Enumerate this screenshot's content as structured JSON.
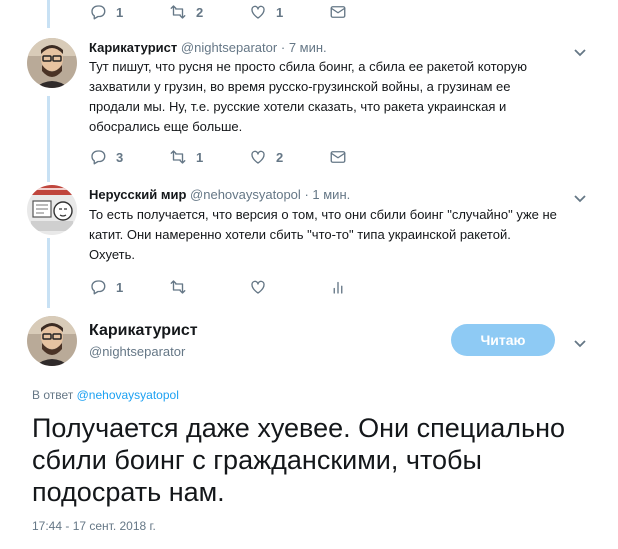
{
  "top_actions": {
    "reply_count": "1",
    "retweet_count": "2",
    "like_count": "1"
  },
  "tweets": [
    {
      "name": "Карикатурист",
      "handle": "@nightseparator",
      "sep": "·",
      "time": "7 мин.",
      "lines": [
        "Тут пишут, что русня не просто сбила боинг, а сбила ее ракетой которую",
        "захватили у грузин, во время русско-грузинской войны, а грузинам ее",
        "продали мы. Ну, т.е. русские хотели сказать, что ракета украинская и",
        "обосрались еще больше."
      ],
      "reply_count": "3",
      "retweet_count": "1",
      "like_count": "2"
    },
    {
      "name": "Нерусский мир",
      "handle": "@nehovaysyatopol",
      "sep": "·",
      "time": "1 мин.",
      "lines": [
        "То есть получается, что версия о том, что они сбили боинг \"случайно\" уже не",
        "катит. Они намеренно хотели сбить \"что-то\" типа украинской ракетой.",
        "Охуеть."
      ],
      "reply_count": "1"
    }
  ],
  "main_tweet": {
    "name": "Карикатурист",
    "handle": "@nightseparator",
    "follow_label": "Читаю",
    "reply_prefix": "В ответ",
    "reply_to": "@nehovaysyatopol",
    "lines": [
      "Получается даже хуевее. Они специально",
      "сбили боинг с гражданскими, чтобы",
      "подосрать нам."
    ],
    "timestamp": "17:44 - 17 сент. 2018 г."
  },
  "colors": {
    "accent": "#1da1f2",
    "follow_button": "#8ecaf4",
    "thread_line": "#c8e1f4",
    "muted": "#657786"
  },
  "icons": [
    "reply-icon",
    "retweet-icon",
    "like-icon",
    "message-icon",
    "analytics-icon",
    "chevron-down-icon"
  ]
}
